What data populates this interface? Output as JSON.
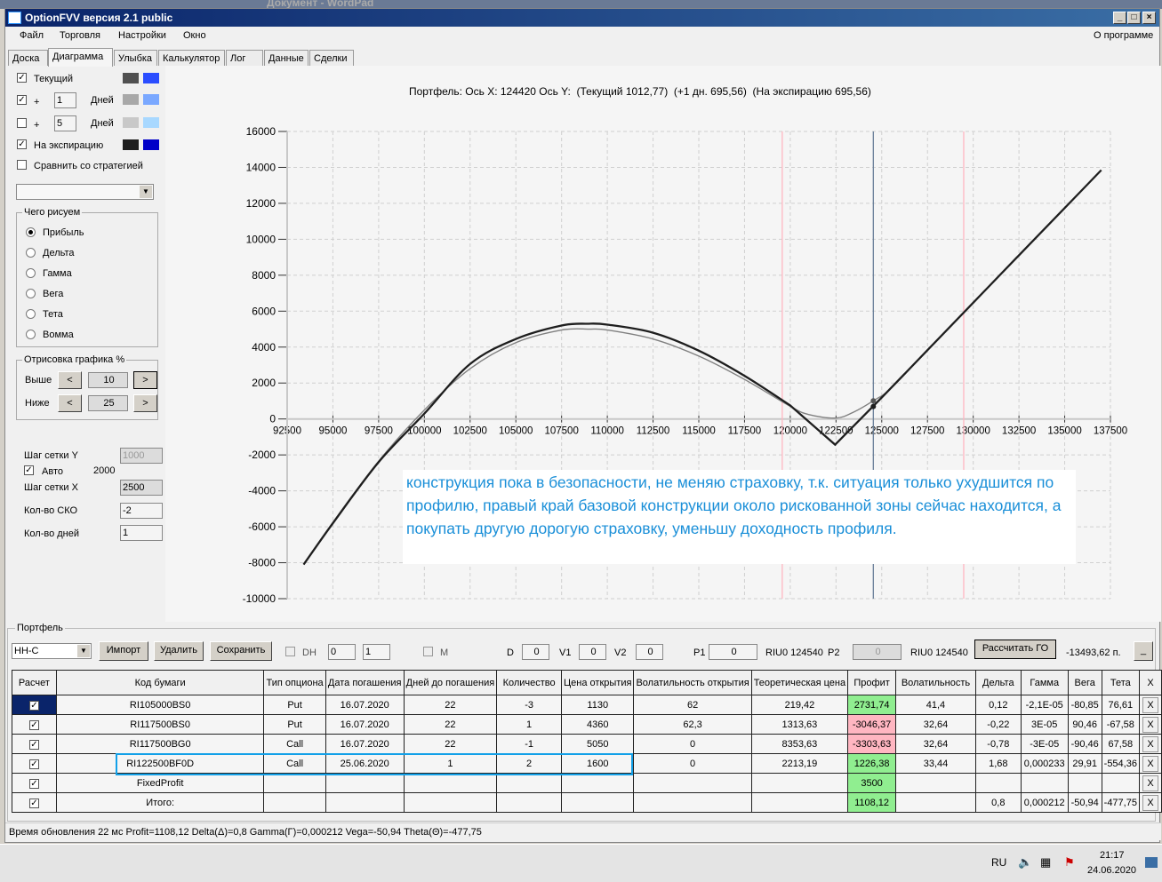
{
  "window": {
    "background_title": "Документ - WordPad",
    "title": "OptionFVV версия 2.1 public"
  },
  "menu": [
    "Файл",
    "Торговля",
    "Настройки",
    "Окно"
  ],
  "about": "О программе",
  "tabs": [
    "Доска",
    "Диаграмма",
    "Улыбка",
    "Калькулятор",
    "Лог",
    "Данные",
    "Сделки"
  ],
  "active_tab": "Диаграмма",
  "left": {
    "current": {
      "label": "Текущий",
      "checked": true,
      "colors": [
        "#505050",
        "#2a4dff"
      ]
    },
    "plus1": {
      "plus": "+",
      "days": "1",
      "label": "Дней",
      "checked": true,
      "colors": [
        "#a8a8a8",
        "#7aa8ff"
      ]
    },
    "plus5": {
      "plus": "+",
      "days": "5",
      "label": "Дней",
      "checked": false,
      "colors": [
        "#c8c8c8",
        "#a8d8ff"
      ]
    },
    "expiry": {
      "label": "На экспирацию",
      "checked": true,
      "colors": [
        "#1e1e1e",
        "#0000c8"
      ]
    },
    "compare": {
      "label": "Сравнить со стратегией",
      "checked": false
    },
    "draw_group": "Чего рисуем",
    "draw_options": [
      "Прибыль",
      "Дельта",
      "Гамма",
      "Вега",
      "Тета",
      "Вомма"
    ],
    "draw_selected": "Прибыль",
    "range_group": "Отрисовка графика %",
    "above_label": "Выше",
    "above_value": "10",
    "below_label": "Ниже",
    "below_value": "25",
    "grid_y_label": "Шаг сетки Y",
    "grid_y_value": "1000",
    "auto_label": "Авто",
    "auto_checked": true,
    "auto_value": "2000",
    "grid_x_label": "Шаг сетки X",
    "grid_x_value": "2500",
    "sko_label": "Кол-во СКО",
    "sko_value": "-2",
    "days_label": "Кол-во дней",
    "days_value": "1"
  },
  "chart_data": {
    "type": "line",
    "title": "Портфель: Ось X: 124420 Ось Y:  (Текущий 1012,77)  (+1 дн. 695,56)  (На экспирацию 695,56)",
    "xlim": [
      92500,
      137500
    ],
    "ylim": [
      -10000,
      16000
    ],
    "x_ticks": [
      92500,
      95000,
      97500,
      100000,
      102500,
      105000,
      107500,
      110000,
      112500,
      115000,
      117500,
      120000,
      122500,
      125000,
      127500,
      130000,
      132500,
      135000,
      137500
    ],
    "y_ticks": [
      16000,
      14000,
      12000,
      10000,
      8000,
      6000,
      4000,
      2000,
      0,
      -2000,
      -4000,
      -6000,
      -8000,
      -10000
    ],
    "grid": true,
    "vlines": [
      {
        "x": 119560,
        "color": "#ffb6c1"
      },
      {
        "x": 124540,
        "color": "#6a7f99"
      },
      {
        "x": 129480,
        "color": "#ffb6c1"
      }
    ],
    "series": [
      {
        "color": "#808080",
        "x": [
          93400,
          95000,
          97500,
          100000,
          102500,
          105000,
          107500,
          109000,
          110000,
          112500,
          115000,
          117500,
          120000,
          121000,
          122500,
          123500,
          124540,
          125500,
          127500
        ],
        "y": [
          -8100,
          -5750,
          -2350,
          500,
          2800,
          4250,
          4950,
          5000,
          4950,
          4450,
          3500,
          2200,
          700,
          250,
          50,
          400,
          1012,
          1700,
          3830
        ]
      },
      {
        "color": "#1e1e1e",
        "x": [
          93400,
          95000,
          97500,
          100000,
          102500,
          105000,
          107500,
          108900,
          110000,
          112500,
          115000,
          117500,
          120000,
          122450,
          125000,
          127500,
          130000,
          132500,
          135000,
          137000
        ],
        "y": [
          -8100,
          -5800,
          -2400,
          300,
          3060,
          4450,
          5200,
          5300,
          5250,
          4800,
          3800,
          2400,
          750,
          -1430,
          1190,
          3830,
          6470,
          9110,
          11740,
          13850
        ]
      }
    ],
    "markers": [
      {
        "x": 124540,
        "y": 1012,
        "color": "#555555"
      },
      {
        "x": 124540,
        "y": 695,
        "color": "#1e1e1e"
      }
    ]
  },
  "annotation": "конструкция пока в безопасности, не меняю страховку, т.к. ситуация только ухудшится по профилю, правый край базовой конструкции около рискованной зоны сейчас находится, а покупать другую дорогую страховку, уменьшу доходность профиля.",
  "portfolio": {
    "group": "Портфель",
    "name": "НН-С",
    "import": "Импорт",
    "delete": "Удалить",
    "save": "Сохранить",
    "dh": "DH",
    "dh_a": "0",
    "dh_b": "1",
    "m": "M",
    "d": "D",
    "d_val": "0",
    "v1": "V1",
    "v1_val": "0",
    "v2": "V2",
    "v2_val": "0",
    "p1": "P1",
    "p1_val": "0",
    "riu1": "RIU0 124540",
    "p2": "P2",
    "p2_val": "0",
    "riu2": "RIU0 124540",
    "calc_go": "Рассчитать ГО",
    "go_value": "-13493,62 п.",
    "min": "_",
    "columns": [
      "Расчет",
      "Код бумаги",
      "Тип опциона",
      "Дата погашения",
      "Дней до погашения",
      "Количество",
      "Цена открытия",
      "Волатильность открытия",
      "Теоретическая цена",
      "Профит",
      "Волатильность",
      "Дельта",
      "Гамма",
      "Вега",
      "Тета",
      "X"
    ],
    "rows": [
      [
        "RI105000BS0",
        "Put",
        "16.07.2020",
        "22",
        "-3",
        "1130",
        "62",
        "219,42",
        "2731,74",
        "41,4",
        "0,12",
        "-2,1E-05",
        "-80,85",
        "76,61"
      ],
      [
        "RI117500BS0",
        "Put",
        "16.07.2020",
        "22",
        "1",
        "4360",
        "62,3",
        "1313,63",
        "-3046,37",
        "32,64",
        "-0,22",
        "3E-05",
        "90,46",
        "-67,58"
      ],
      [
        "RI117500BG0",
        "Call",
        "16.07.2020",
        "22",
        "-1",
        "5050",
        "0",
        "8353,63",
        "-3303,63",
        "32,64",
        "-0,78",
        "-3E-05",
        "-90,46",
        "67,58"
      ],
      [
        "RI122500BF0D",
        "Call",
        "25.06.2020",
        "1",
        "2",
        "1600",
        "0",
        "2213,19",
        "1226,38",
        "33,44",
        "1,68",
        "0,000233",
        "29,91",
        "-554,36"
      ],
      [
        "FixedProfit",
        "",
        "",
        "",
        "",
        "",
        "",
        "",
        "3500",
        "",
        "",
        "",
        "",
        ""
      ],
      [
        "Итого:",
        "",
        "",
        "",
        "",
        "",
        "",
        "",
        "1108,12",
        "",
        "0,8",
        "0,000212",
        "-50,94",
        "-477,75"
      ]
    ],
    "profit_colors": [
      "g",
      "r",
      "r",
      "g",
      "g",
      "g"
    ],
    "x_label": "X"
  },
  "status": "Время обновления 22 мс  Profit=1108,12 Delta(Δ)=0,8 Gamma(Γ)=0,000212 Vega=-50,94 Theta(Θ)=-477,75",
  "taskbar": {
    "lang": "RU",
    "time": "21:17",
    "date": "24.06.2020"
  }
}
